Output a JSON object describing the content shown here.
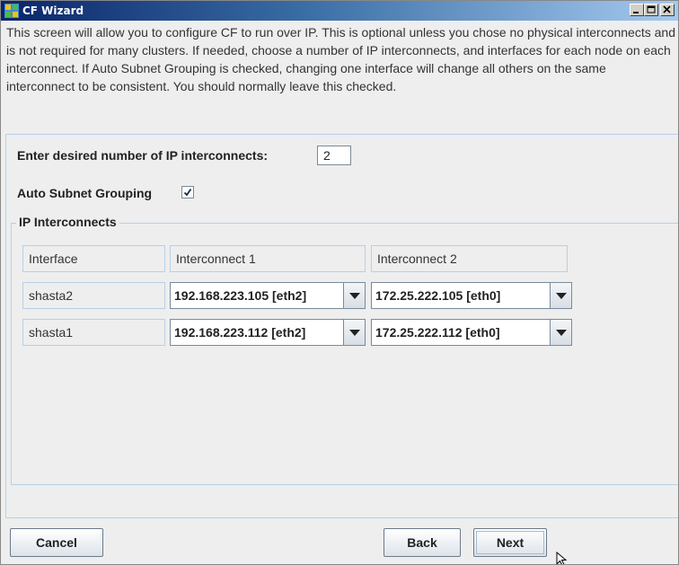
{
  "window": {
    "title": "CF Wizard",
    "icon": "cf-wizard-app-icon",
    "controls": [
      "minimize-icon",
      "maximize-icon",
      "close-icon"
    ]
  },
  "description": "This screen will allow you to configure CF to run over IP.  This is optional unless you chose no physical interconnects and is not required for many clusters.  If needed, choose a number of IP interconnects, and interfaces for each node on each interconnect.  If Auto Subnet Grouping is checked, changing one interface will change all others on the same interconnect to be consistent.  You should normally leave this checked.",
  "form": {
    "count_label": "Enter desired number of IP interconnects:",
    "count_value": "2",
    "auto_subnet_label": "Auto Subnet Grouping",
    "auto_subnet_checked": true
  },
  "interconnects": {
    "group_title": "IP Interconnects",
    "headers": [
      "Interface",
      "Interconnect 1",
      "Interconnect 2"
    ],
    "rows": [
      {
        "node": "shasta2",
        "ic1": "192.168.223.105 [eth2]",
        "ic2": "172.25.222.105 [eth0]"
      },
      {
        "node": "shasta1",
        "ic1": "192.168.223.112 [eth2]",
        "ic2": "172.25.222.112 [eth0]"
      }
    ]
  },
  "buttons": {
    "cancel": "Cancel",
    "back": "Back",
    "next": "Next"
  },
  "colors": {
    "title_gradient_start": "#0a246a",
    "title_gradient_end": "#a6caf0",
    "panel_border": "#b8cfe5",
    "background": "#eeeeee"
  }
}
